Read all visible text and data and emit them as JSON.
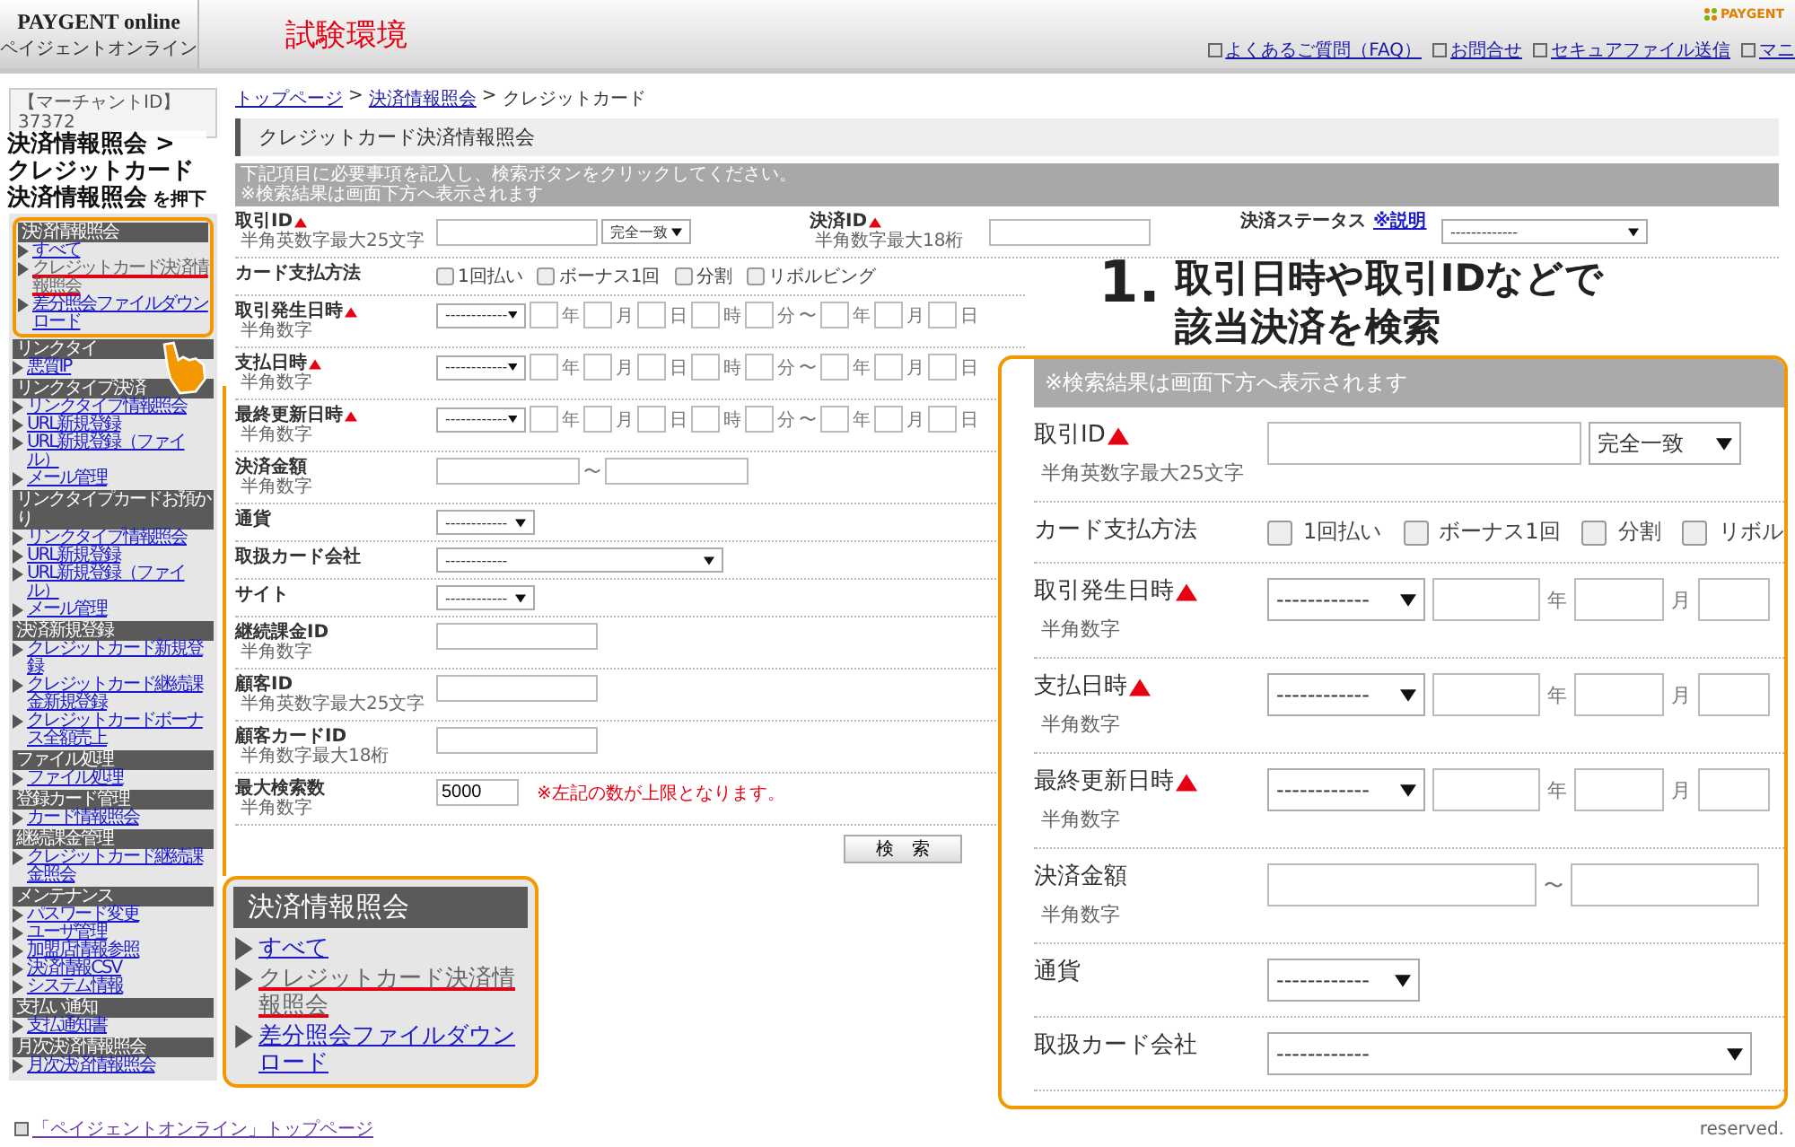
{
  "header": {
    "logo": "PAYGENT online",
    "logo_sub": "ペイジェントオンライン",
    "environment": "試験環境",
    "brand": "PAYGENT",
    "links": [
      "よくあるご質問（FAQ）",
      "お問合せ",
      "セキュアファイル送信",
      "マニ"
    ]
  },
  "sidebar": {
    "merchant_label": "【マーチャントID】",
    "merchant_id": "37372",
    "sections": [
      {
        "title": "決済情報照会",
        "highlighted": true,
        "items": [
          {
            "label": "すべて",
            "current": false
          },
          {
            "label": "クレジットカード決済情報照会",
            "current": true
          },
          {
            "label": "差分照会ファイルダウンロード",
            "current": false
          }
        ]
      },
      {
        "title": "リンクタイ",
        "items": [
          {
            "label": "悪質IP",
            "current": false
          }
        ]
      },
      {
        "title": "リンクタイプ決済",
        "items": [
          {
            "label": "リンクタイプ情報照会",
            "current": false
          },
          {
            "label": "URL新規登録",
            "current": false
          },
          {
            "label": "URL新規登録（ファイル）",
            "current": false
          },
          {
            "label": "メール管理",
            "current": false
          }
        ]
      },
      {
        "title": "リンクタイプカードお預かり",
        "items": [
          {
            "label": "リンクタイプ情報照会",
            "current": false
          },
          {
            "label": "URL新規登録",
            "current": false
          },
          {
            "label": "URL新規登録（ファイル）",
            "current": false
          },
          {
            "label": "メール管理",
            "current": false
          }
        ]
      },
      {
        "title": "決済新規登録",
        "items": [
          {
            "label": "クレジットカード新規登録",
            "current": false
          },
          {
            "label": "クレジットカード継続課金新規登録",
            "current": false
          },
          {
            "label": "クレジットカードボーナス全額売上",
            "current": false
          }
        ]
      },
      {
        "title": "ファイル処理",
        "items": [
          {
            "label": "ファイル処理",
            "current": false
          }
        ]
      },
      {
        "title": "登録カード管理",
        "items": [
          {
            "label": "カード情報照会",
            "current": false
          }
        ]
      },
      {
        "title": "継続課金管理",
        "items": [
          {
            "label": "クレジットカード継続課金照会",
            "current": false
          }
        ]
      },
      {
        "title": "メンテナンス",
        "items": [
          {
            "label": "パスワード変更",
            "current": false
          },
          {
            "label": "ユーザ管理",
            "current": false
          },
          {
            "label": "加盟店情報参照",
            "current": false
          },
          {
            "label": "決済情報CSV",
            "current": false
          },
          {
            "label": "システム情報",
            "current": false
          }
        ]
      },
      {
        "title": "支払い通知",
        "items": [
          {
            "label": "支払通知書",
            "current": false
          }
        ]
      },
      {
        "title": "月次決済情報照会",
        "items": [
          {
            "label": "月次決済情報照会",
            "current": false
          }
        ]
      }
    ]
  },
  "breadcrumb": {
    "separator": ">",
    "items": [
      {
        "label": "トップページ",
        "link": true
      },
      {
        "label": "決済情報照会",
        "link": true
      },
      {
        "label": "クレジットカード",
        "link": false
      }
    ]
  },
  "page_title": "クレジットカード決済情報照会",
  "instructions": [
    "下記項目に必要事項を記入し、検索ボタンをクリックしてください。",
    "※検索結果は画面下方へ表示されます"
  ],
  "search_top": {
    "fields": [
      {
        "kind": "text",
        "label": "取引ID",
        "required": true,
        "hint": "半角英数字最大25文字",
        "match": "完全一致"
      },
      {
        "kind": "text",
        "label": "決済ID",
        "required": true,
        "hint": "半角数字最大18桁"
      },
      {
        "kind": "select",
        "label": "決済ステータス",
        "required": false,
        "help": "※説明",
        "select": "-------------"
      }
    ]
  },
  "form": {
    "rows": [
      {
        "kind": "checkboxes",
        "label": "カード支払方法",
        "required": false,
        "options": [
          {
            "label": "1回払い",
            "checked": false
          },
          {
            "label": "ボーナス1回",
            "checked": false
          },
          {
            "label": "分割",
            "checked": false
          },
          {
            "label": "リボルビング",
            "checked": false
          }
        ]
      },
      {
        "kind": "datetime",
        "label": "取引発生日時",
        "required": true,
        "hint": "半角数字",
        "select": "------------",
        "units_from": [
          "年",
          "月",
          "日",
          "時",
          "分"
        ],
        "separator": "〜",
        "units_to": [
          "年",
          "月",
          "日"
        ]
      },
      {
        "kind": "datetime",
        "label": "支払日時",
        "required": true,
        "hint": "半角数字",
        "select": "------------",
        "units_from": [
          "年",
          "月",
          "日",
          "時",
          "分"
        ],
        "separator": "〜",
        "units_to": [
          "年",
          "月",
          "日"
        ]
      },
      {
        "kind": "datetime",
        "label": "最終更新日時",
        "required": true,
        "hint": "半角数字",
        "select": "------------",
        "units_from": [
          "年",
          "月",
          "日",
          "時",
          "分"
        ],
        "separator": "〜",
        "units_to": [
          "年",
          "月",
          "日"
        ]
      },
      {
        "kind": "range",
        "label": "決済金額",
        "required": false,
        "hint": "半角数字",
        "separator": "〜"
      },
      {
        "kind": "select",
        "label": "通貨",
        "required": false,
        "select": "------------",
        "wide": false
      },
      {
        "kind": "select",
        "label": "取扱カード会社",
        "required": false,
        "select": "------------",
        "wide": true
      },
      {
        "kind": "select",
        "label": "サイト",
        "required": false,
        "select": "------------",
        "wide": false
      },
      {
        "kind": "text",
        "label": "継続課金ID",
        "required": false,
        "hint": "半角数字"
      },
      {
        "kind": "text",
        "label": "顧客ID",
        "required": false,
        "hint": "半角英数字最大25文字"
      },
      {
        "kind": "text",
        "label": "顧客カードID",
        "required": false,
        "hint": "半角数字最大18桁"
      },
      {
        "kind": "text",
        "label": "最大検索数",
        "required": false,
        "hint": "半角数字",
        "value": "5000",
        "note": "※左記の数が上限となります。"
      }
    ],
    "submit": "検　索"
  },
  "callout_form": {
    "instruction": "※検索結果は画面下方へ表示されます",
    "rows": [
      {
        "kind": "text",
        "label": "取引ID",
        "required": true,
        "hint": "半角英数字最大25文字",
        "match": "完全一致"
      },
      {
        "kind": "checkboxes",
        "label": "カード支払方法",
        "required": false,
        "options": [
          {
            "label": "1回払い",
            "checked": false
          },
          {
            "label": "ボーナス1回",
            "checked": false
          },
          {
            "label": "分割",
            "checked": false
          },
          {
            "label": "リボル",
            "checked": false
          }
        ]
      },
      {
        "kind": "datetime",
        "label": "取引発生日時",
        "required": true,
        "hint": "半角数字",
        "select": "------------",
        "units_from": [
          "年",
          "月"
        ]
      },
      {
        "kind": "datetime",
        "label": "支払日時",
        "required": true,
        "hint": "半角数字",
        "select": "------------",
        "units_from": [
          "年",
          "月"
        ]
      },
      {
        "kind": "datetime",
        "label": "最終更新日時",
        "required": true,
        "hint": "半角数字",
        "select": "------------",
        "units_from": [
          "年",
          "月"
        ]
      },
      {
        "kind": "range",
        "label": "決済金額",
        "required": false,
        "hint": "半角数字",
        "separator": "〜"
      },
      {
        "kind": "select",
        "label": "通貨",
        "required": false,
        "select": "------------",
        "wide": false
      },
      {
        "kind": "select",
        "label": "取扱カード会社",
        "required": false,
        "select": "------------",
        "wide": true
      }
    ]
  },
  "zoom_callout": {
    "title": "決済情報照会",
    "items": [
      {
        "label": "すべて",
        "current": false
      },
      {
        "label": "クレジットカード決済情報照会",
        "current": true
      },
      {
        "label": "差分照会ファイルダウンロード",
        "current": false
      }
    ]
  },
  "step_hint": {
    "lines": [
      "決済情報照会 >",
      "クレジットカード",
      "決済情報照会"
    ],
    "suffix": "を押下"
  },
  "step_one": {
    "number": "1.",
    "lines": [
      "取引日時や取引IDなどで",
      "該当決済を検索"
    ]
  },
  "footer": {
    "link": "「ペイジェントオンライン」トップページ",
    "copyright": "reserved."
  }
}
